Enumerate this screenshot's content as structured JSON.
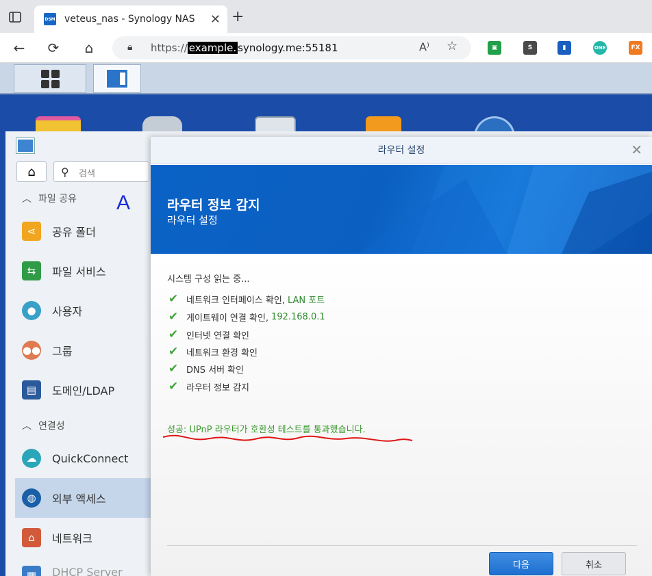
{
  "browser": {
    "tab_title": "veteus_nas - Synology NAS",
    "favicon_text": "DSM",
    "url_highlight": "example.",
    "url_host": "synology.me:55181",
    "url_prefix": "https://",
    "extensions": [
      {
        "name": "green-ext",
        "color": "#22a04a",
        "text": "▣"
      },
      {
        "name": "s-ext",
        "color": "#4a4a4a",
        "text": "S"
      },
      {
        "name": "blue-ext",
        "color": "#1a5fc0",
        "text": "▮"
      },
      {
        "name": "one-ext",
        "color": "#23b7a8",
        "text": "ONE"
      },
      {
        "name": "fx-ext",
        "color": "#f07a22",
        "text": "FX"
      }
    ]
  },
  "sidebar": {
    "search_placeholder": "검색",
    "annotation": "A",
    "sections": [
      {
        "label": "파일 공유"
      },
      {
        "label": "연결성"
      }
    ],
    "items": [
      {
        "label": "공유 폴더",
        "icon": "shared-folder-icon",
        "color": "#f2a51e"
      },
      {
        "label": "파일 서비스",
        "icon": "file-services-icon",
        "color": "#2f9b46"
      },
      {
        "label": "사용자",
        "icon": "user-icon",
        "color": "#3aa0c8"
      },
      {
        "label": "그룹",
        "icon": "group-icon",
        "color": "#e07a50"
      },
      {
        "label": "도메인/LDAP",
        "icon": "domain-ldap-icon",
        "color": "#2b5a9c"
      },
      {
        "label": "QuickConnect",
        "icon": "quickconnect-icon",
        "color": "#2aa6b8"
      },
      {
        "label": "외부 액세스",
        "icon": "external-access-icon",
        "color": "#1b5fa8"
      },
      {
        "label": "네트워크",
        "icon": "network-icon",
        "color": "#d25a3a"
      },
      {
        "label": "DHCP Server",
        "icon": "dhcp-server-icon",
        "color": "#3a7bc8"
      }
    ]
  },
  "dialog": {
    "title": "라우터 설정",
    "banner_title": "라우터 정보 감지",
    "banner_sub": "라우터 설정",
    "reading": "시스템 구성 읽는 중...",
    "checks": [
      {
        "text": "네트워크 인터페이스 확인,",
        "value": "LAN 포트"
      },
      {
        "text": "게이트웨이 연결 확인,",
        "value": "192.168.0.1"
      },
      {
        "text": "인터넷 연결 확인",
        "value": ""
      },
      {
        "text": "네트워크 환경 확인",
        "value": ""
      },
      {
        "text": "DNS 서버 확인",
        "value": ""
      },
      {
        "text": "라우터 정보 감지",
        "value": ""
      }
    ],
    "success": "성공: UPnP 라우터가 호환성 테스트를 통과했습니다.",
    "next_label": "다음",
    "cancel_label": "취소"
  }
}
